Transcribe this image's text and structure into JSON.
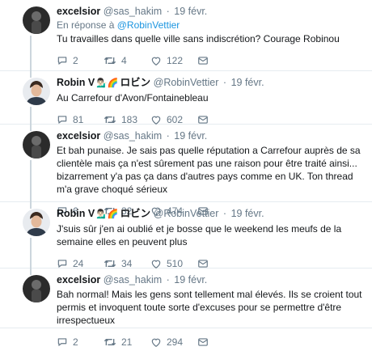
{
  "tweets": [
    {
      "name": "excelsior",
      "handle": "@sas_hakim",
      "time": "19 févr.",
      "reply_prefix": "En réponse à",
      "reply_mention": "@RobinVettier",
      "text": "Tu travailles dans quelle ville sans indiscrétion? Courage Robinou",
      "replies": "2",
      "retweets": "4",
      "likes": "122",
      "avatar": "profile-photo-dark"
    },
    {
      "name": "Robin V",
      "emoji": "💁🏻‍♂️🌈",
      "katakana": "ロビン",
      "handle": "@RobinVettier",
      "time": "19 févr.",
      "text": "Au Carrefour d'Avon/Fontainebleau",
      "replies": "81",
      "retweets": "183",
      "likes": "602",
      "avatar": "profile-photo-man"
    },
    {
      "name": "excelsior",
      "handle": "@sas_hakim",
      "time": "19 févr.",
      "text": "Et bah punaise. Je sais pas quelle réputation a Carrefour auprès de sa clientèle mais ça n'est sûrement pas une raison pour être traité ainsi... bizarrement y'a pas ça dans d'autres pays comme en UK. Ton thread m'a grave choqué sérieux",
      "replies": "6",
      "retweets": "32",
      "likes": "474",
      "avatar": "profile-photo-dark"
    },
    {
      "name": "Robin V",
      "emoji": "💁🏻‍♂️🌈",
      "katakana": "ロビン",
      "handle": "@RobinVettier",
      "time": "19 févr.",
      "text": "J'suis sûr j'en ai oublié et je bosse que le weekend les meufs de la semaine elles en peuvent plus",
      "replies": "24",
      "retweets": "34",
      "likes": "510",
      "avatar": "profile-photo-man"
    },
    {
      "name": "excelsior",
      "handle": "@sas_hakim",
      "time": "19 févr.",
      "text": "Bah normal! Mais les gens sont tellement mal élevés. Ils se croient tout permis et invoquent toute sorte d'excuses pour se permettre d'être irrespectueux",
      "replies": "2",
      "retweets": "21",
      "likes": "294",
      "avatar": "profile-photo-dark"
    }
  ],
  "colors": {
    "text": "#14171a",
    "muted": "#657786",
    "link": "#1b95e0",
    "divider": "#e6ecf0",
    "thread_line": "#ccd6dd"
  },
  "icons": [
    "reply-icon",
    "retweet-icon",
    "like-icon",
    "dm-icon"
  ]
}
